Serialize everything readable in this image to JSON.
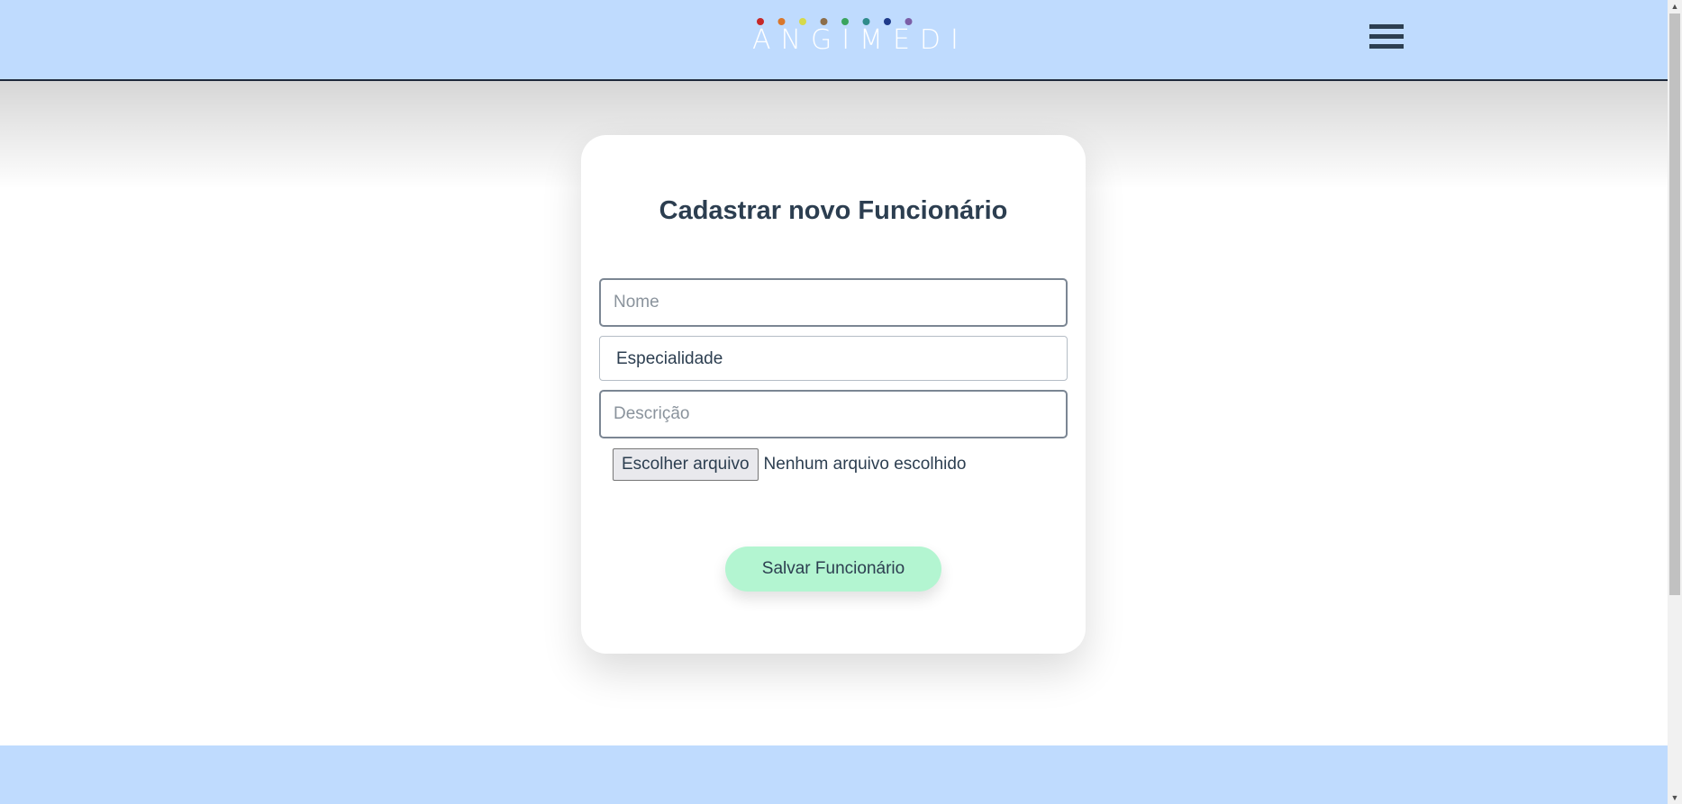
{
  "header": {
    "logo_text": "ANGIMEDI",
    "logo_dot_colors": [
      "#c62828",
      "#d9772b",
      "#d6d94a",
      "#8d6e4a",
      "#3aa45e",
      "#2e8b8b",
      "#1e3a8a",
      "#7b5ea7"
    ],
    "menu_icon": "hamburger-menu-icon"
  },
  "form": {
    "title": "Cadastrar novo Funcionário",
    "name_placeholder": "Nome",
    "specialty_selected": "Especialidade",
    "description_placeholder": "Descrição",
    "file_button_label": "Escolher arquivo",
    "file_status": "Nenhum arquivo escolhido",
    "save_label": "Salvar Funcionário"
  },
  "colors": {
    "header_bg": "#bfdbfe",
    "save_button_bg": "#b3f5d1",
    "text": "#2c3e50"
  }
}
